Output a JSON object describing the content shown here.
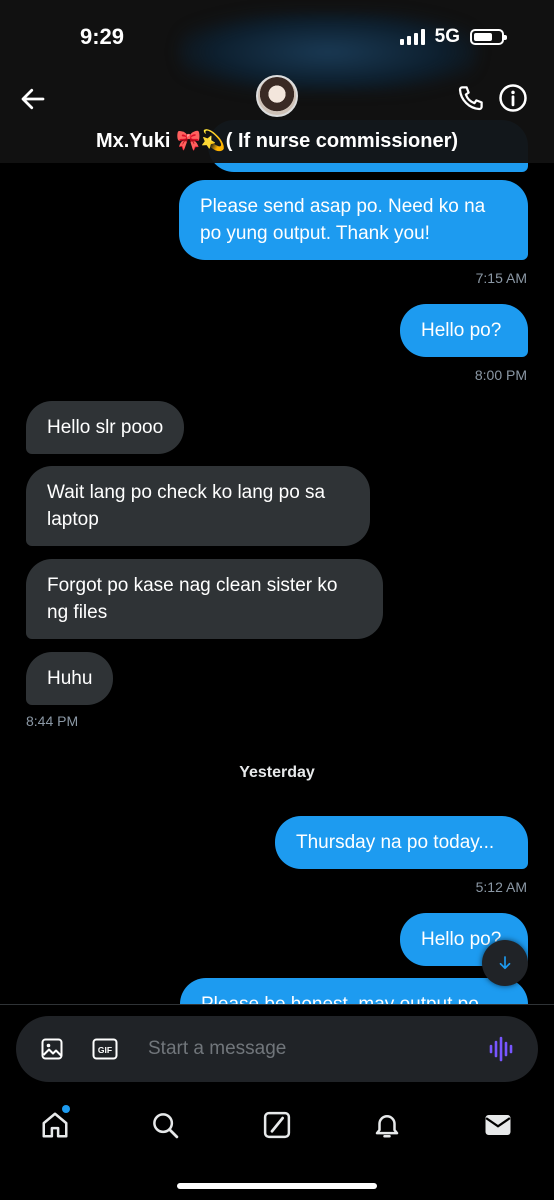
{
  "status_bar": {
    "time": "9:29",
    "network": "5G"
  },
  "header": {
    "contact_name": "Mx.Yuki 🎀💫( If nurse commissioner)"
  },
  "messages": [
    {
      "text": "Please send asap po. Need ko na po yung output. Thank you!",
      "timestamp": "7:15 AM"
    },
    {
      "text": "Hello po?",
      "timestamp": "8:00 PM"
    },
    {
      "text": "Hello slr pooo"
    },
    {
      "text": "Wait lang po check ko lang po sa laptop"
    },
    {
      "text": "Forgot po kase nag clean sister ko ng files"
    },
    {
      "text": "Huhu",
      "timestamp": "8:44 PM"
    },
    {
      "text": "Thursday na po today...",
      "timestamp": "5:12 AM"
    },
    {
      "text": "Hello po?"
    },
    {
      "text": "Please be honest, may output po"
    }
  ],
  "date_separator": "Yesterday",
  "composer": {
    "placeholder": "Start a message",
    "gif_label": "GIF"
  },
  "colors": {
    "accent": "#1d9bf0",
    "received_bubble": "#2f3336",
    "voice": "#7856ff"
  },
  "nav": [
    "home-icon",
    "search-icon",
    "grok-icon",
    "notifications-icon",
    "messages-icon"
  ]
}
